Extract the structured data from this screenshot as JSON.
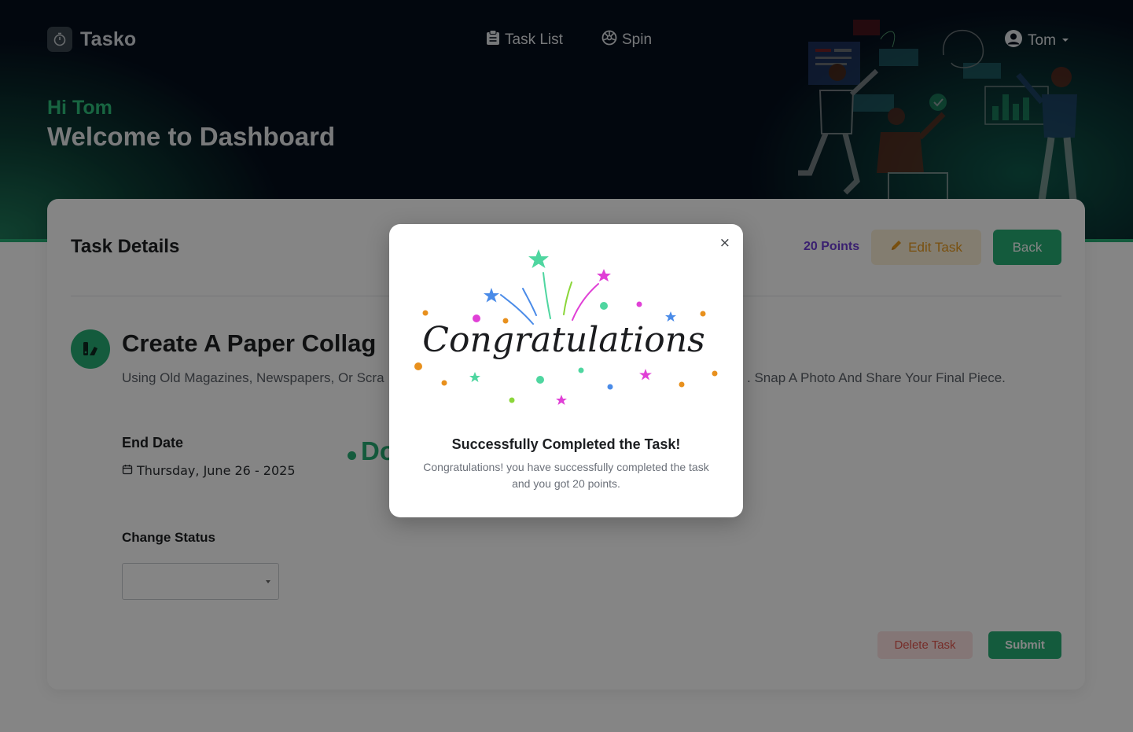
{
  "header": {
    "app_name": "Tasko",
    "nav": [
      {
        "label": "Task List",
        "icon": "clipboard-icon"
      },
      {
        "label": "Spin",
        "icon": "wheel-icon"
      }
    ],
    "user_name": "Tom",
    "greeting": "Hi Tom",
    "welcome": "Welcome to Dashboard"
  },
  "task_card": {
    "title": "Task Details",
    "points": "20 Points",
    "edit_label": "Edit Task",
    "back_label": "Back",
    "task_name": "Create A Paper Collag",
    "description_left": "Using Old Magazines, Newspapers, Or Scra",
    "description_right": ". Snap A Photo And Share Your Final Piece.",
    "end_date_label": "End Date",
    "end_date_value": "Thursday, June 26 - 2025",
    "status_text": "Do",
    "change_status_label": "Change Status",
    "status_select_value": "",
    "delete_label": "Delete Task",
    "submit_label": "Submit"
  },
  "modal": {
    "close_symbol": "×",
    "celebration_text": "Congratulations",
    "title": "Successfully Completed the Task!",
    "message": "Congratulations! you have successfully completed the task and you got 20 points."
  },
  "colors": {
    "accent_green": "#27ae75",
    "points_purple": "#6f3fd6",
    "edit_orange": "#e89a1d",
    "delete_red": "#e2574f",
    "header_dark": "#050e1c"
  }
}
